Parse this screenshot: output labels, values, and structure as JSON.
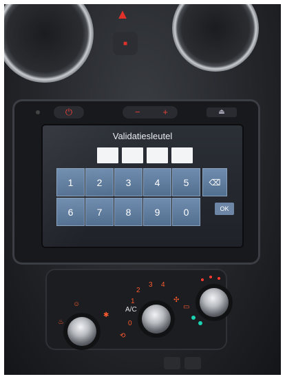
{
  "screen": {
    "title": "Validatiesleutel",
    "code_boxes": [
      "",
      "",
      "",
      ""
    ],
    "keypad": {
      "row1": [
        "1",
        "2",
        "3",
        "4",
        "5"
      ],
      "row2": [
        "6",
        "7",
        "8",
        "9",
        "0"
      ],
      "backspace_icon": "backspace-icon",
      "ok_label": "OK"
    }
  },
  "head_unit": {
    "power_icon": "power-icon",
    "volume_minus": "−",
    "volume_plus": "+",
    "eject_icon": "eject-icon"
  },
  "climate": {
    "fan_levels": [
      "1",
      "2",
      "3",
      "4"
    ],
    "ac_label": "A/C",
    "zero_label": "0"
  },
  "colors": {
    "accent_red": "#e0322a",
    "key_blue": "#5f7c9f",
    "teal": "#1bd3b2"
  }
}
